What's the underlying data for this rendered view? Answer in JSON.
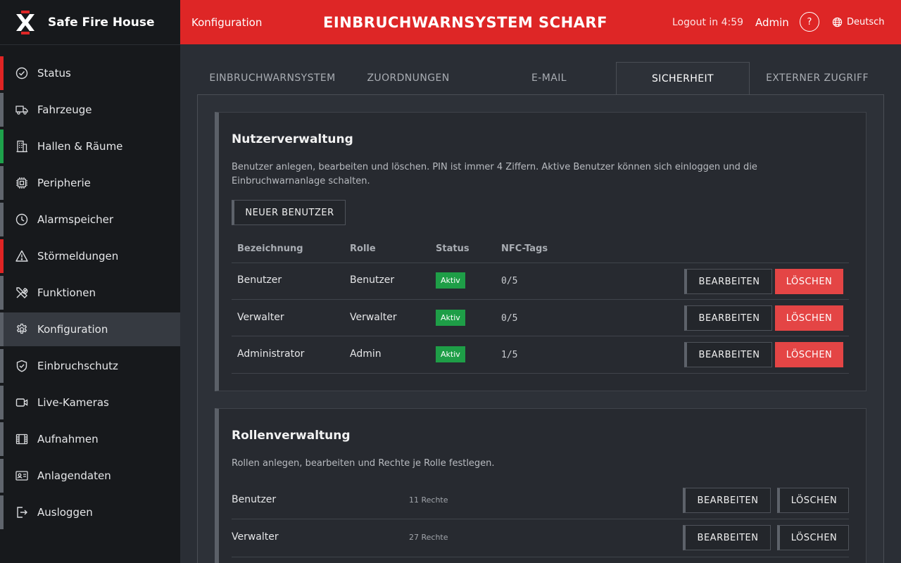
{
  "brand": {
    "name": "Safe Fire House"
  },
  "sidebar": {
    "items": [
      {
        "label": "Status",
        "icon": "check-circle-icon"
      },
      {
        "label": "Fahrzeuge",
        "icon": "truck-icon"
      },
      {
        "label": "Hallen & Räume",
        "icon": "building-icon"
      },
      {
        "label": "Peripherie",
        "icon": "chip-icon"
      },
      {
        "label": "Alarmspeicher",
        "icon": "clock-icon"
      },
      {
        "label": "Störmeldungen",
        "icon": "warning-icon"
      },
      {
        "label": "Funktionen",
        "icon": "tools-icon"
      },
      {
        "label": "Konfiguration",
        "icon": "gear-icon"
      },
      {
        "label": "Einbruchschutz",
        "icon": "shield-icon"
      },
      {
        "label": "Live-Kameras",
        "icon": "video-icon"
      },
      {
        "label": "Aufnahmen",
        "icon": "film-icon"
      },
      {
        "label": "Anlagendaten",
        "icon": "id-card-icon"
      },
      {
        "label": "Ausloggen",
        "icon": "logout-icon"
      }
    ],
    "active": "Konfiguration"
  },
  "header": {
    "section": "Konfiguration",
    "title": "EINBRUCHWARNSYSTEM SCHARF",
    "logout": "Logout in 4:59",
    "user": "Admin",
    "help": "?",
    "language": "Deutsch",
    "color": "#de2626"
  },
  "tabs": [
    {
      "label": "EINBRUCHWARNSYSTEM"
    },
    {
      "label": "ZUORDNUNGEN"
    },
    {
      "label": "E-MAIL"
    },
    {
      "label": "SICHERHEIT"
    },
    {
      "label": "EXTERNER ZUGRIFF"
    }
  ],
  "active_tab": "SICHERHEIT",
  "users_panel": {
    "title": "Nutzerverwaltung",
    "description": "Benutzer anlegen, bearbeiten und löschen. PIN ist immer 4 Ziffern. Aktive Benutzer können sich einloggen und die Einbruchwarnanlage schalten.",
    "new_button": "NEUER BENUTZER",
    "columns": [
      "Bezeichnung",
      "Rolle",
      "Status",
      "NFC-Tags"
    ],
    "rows": [
      {
        "name": "Benutzer",
        "role": "Benutzer",
        "status": "Aktiv",
        "nfc": "0/5",
        "edit": "BEARBEITEN",
        "delete": "LÖSCHEN"
      },
      {
        "name": "Verwalter",
        "role": "Verwalter",
        "status": "Aktiv",
        "nfc": "0/5",
        "edit": "BEARBEITEN",
        "delete": "LÖSCHEN"
      },
      {
        "name": "Administrator",
        "role": "Admin",
        "status": "Aktiv",
        "nfc": "1/5",
        "edit": "BEARBEITEN",
        "delete": "LÖSCHEN"
      }
    ]
  },
  "roles_panel": {
    "title": "Rollenverwaltung",
    "description": "Rollen anlegen, bearbeiten und Rechte je Rolle festlegen.",
    "rows": [
      {
        "name": "Benutzer",
        "rights": "11 Rechte",
        "edit": "BEARBEITEN",
        "delete": "LÖSCHEN"
      },
      {
        "name": "Verwalter",
        "rights": "27 Rechte",
        "edit": "BEARBEITEN",
        "delete": "LÖSCHEN"
      }
    ]
  }
}
